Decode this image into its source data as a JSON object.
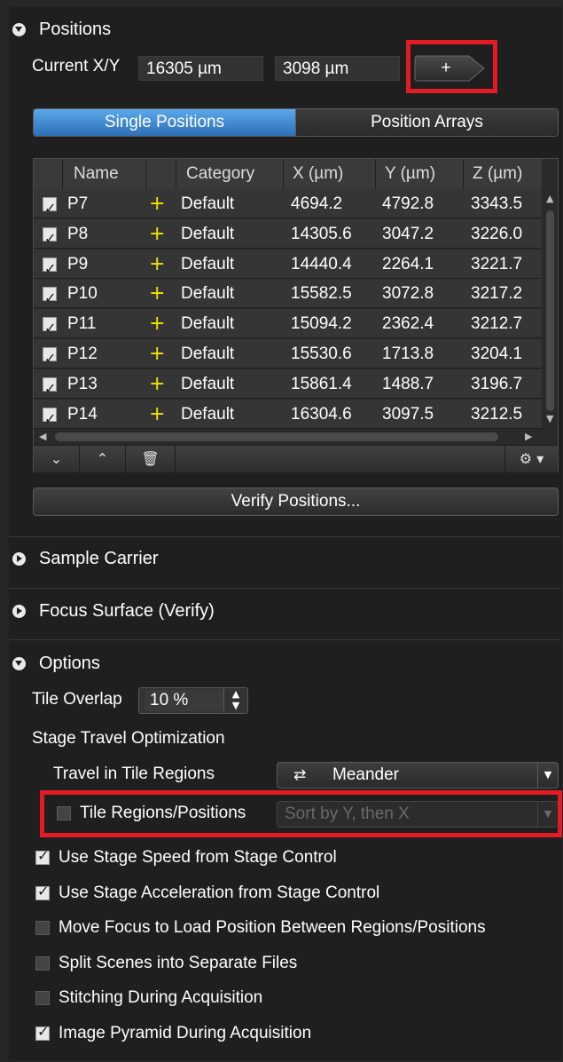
{
  "positions": {
    "title": "Positions",
    "current_xy_label": "Current X/Y",
    "current_x": "16305 µm",
    "current_y": "3098 µm",
    "add_label": "+",
    "tabs": [
      "Single Positions",
      "Position Arrays"
    ],
    "active_tab": "Single Positions",
    "columns": [
      "Name",
      "Category",
      "X (µm)",
      "Y (µm)",
      "Z (µm)"
    ],
    "rows": [
      {
        "checked": true,
        "name": "P7",
        "marker": "+",
        "category": "Default",
        "x": "4694.2",
        "y": "4792.8",
        "z": "3343.5"
      },
      {
        "checked": true,
        "name": "P8",
        "marker": "+",
        "category": "Default",
        "x": "14305.6",
        "y": "3047.2",
        "z": "3226.0"
      },
      {
        "checked": true,
        "name": "P9",
        "marker": "+",
        "category": "Default",
        "x": "14440.4",
        "y": "2264.1",
        "z": "3221.7"
      },
      {
        "checked": true,
        "name": "P10",
        "marker": "+",
        "category": "Default",
        "x": "15582.5",
        "y": "3072.8",
        "z": "3217.2"
      },
      {
        "checked": true,
        "name": "P11",
        "marker": "+",
        "category": "Default",
        "x": "15094.2",
        "y": "2362.4",
        "z": "3212.7"
      },
      {
        "checked": true,
        "name": "P12",
        "marker": "+",
        "category": "Default",
        "x": "15530.6",
        "y": "1713.8",
        "z": "3204.1"
      },
      {
        "checked": true,
        "name": "P13",
        "marker": "+",
        "category": "Default",
        "x": "15861.4",
        "y": "1488.7",
        "z": "3196.7"
      },
      {
        "checked": true,
        "name": "P14",
        "marker": "+",
        "category": "Default",
        "x": "16304.6",
        "y": "3097.5",
        "z": "3212.5"
      }
    ],
    "toolbar_icons": [
      "move-down-icon",
      "move-up-icon",
      "trash-icon",
      "gear-icon"
    ],
    "verify_label": "Verify Positions..."
  },
  "sections": {
    "sample_carrier": "Sample Carrier",
    "focus_surface": "Focus Surface (Verify)",
    "options": "Options"
  },
  "options": {
    "tile_overlap_label": "Tile Overlap",
    "tile_overlap_value": "10 %",
    "stage_travel_label": "Stage Travel Optimization",
    "travel_tile_regions_label": "Travel in Tile Regions",
    "travel_tile_regions_value": "Meander",
    "tile_regions_positions_label": "Tile Regions/Positions",
    "tile_regions_positions_checked": false,
    "tile_regions_positions_value": "Sort by Y, then X",
    "checkboxes": [
      {
        "label": "Use Stage Speed from Stage Control",
        "checked": true
      },
      {
        "label": "Use Stage Acceleration from Stage Control",
        "checked": true
      },
      {
        "label": "Move Focus to Load Position Between Regions/Positions",
        "checked": false
      },
      {
        "label": "Split Scenes into Separate Files",
        "checked": false
      },
      {
        "label": "Stitching During Acquisition",
        "checked": false
      },
      {
        "label": "Image Pyramid During Acquisition",
        "checked": true
      }
    ]
  },
  "colors": {
    "highlight_box": "#e21b24",
    "active_tab": "#3d8ad4",
    "marker": "#f0e400"
  }
}
